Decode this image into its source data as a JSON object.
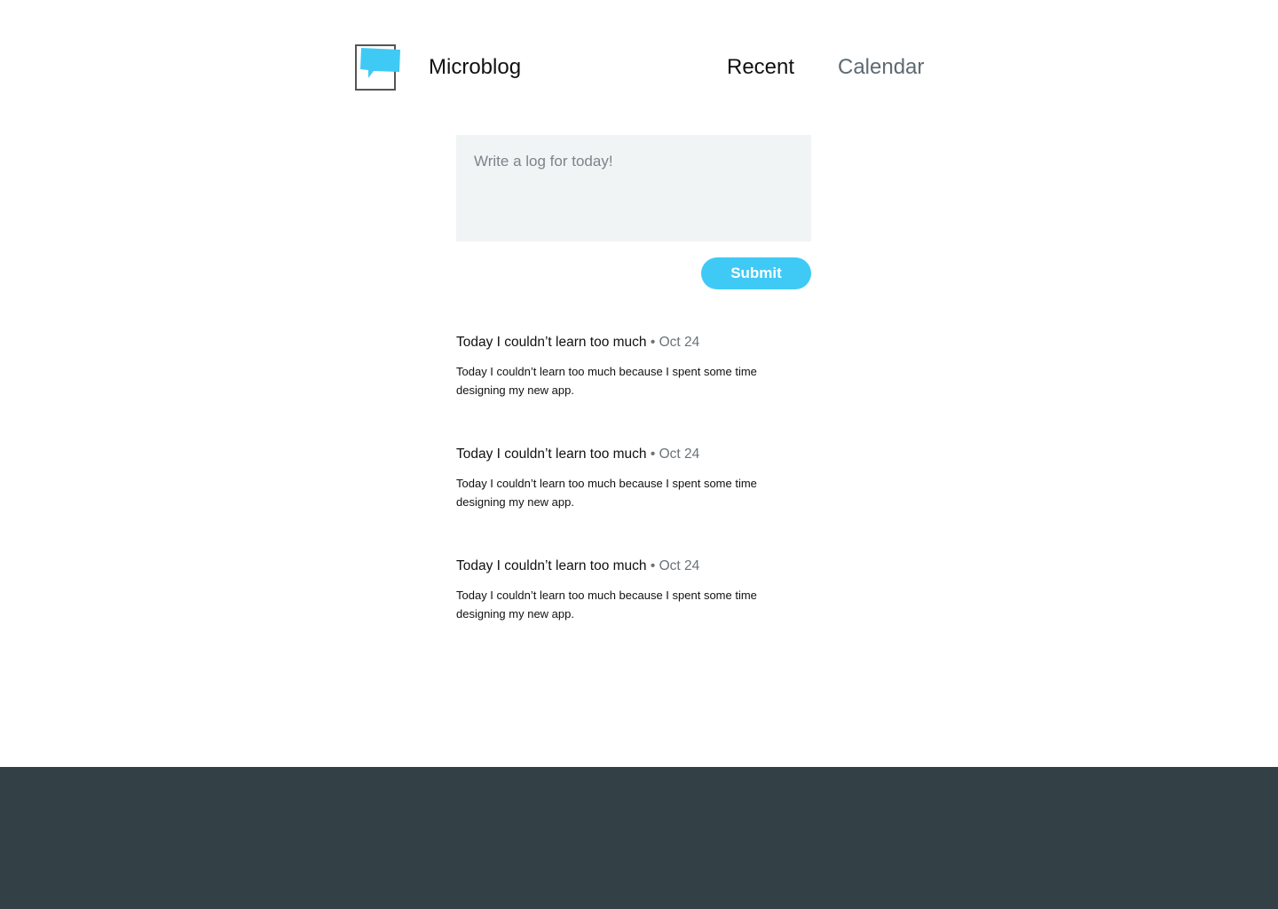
{
  "header": {
    "brand": "Microblog",
    "logo_icon": "speech-bubble-icon",
    "nav": [
      {
        "label": "Recent",
        "active": true
      },
      {
        "label": "Calendar",
        "active": false
      }
    ]
  },
  "composer": {
    "placeholder": "Write a log for today!",
    "value": ""
  },
  "submit_label": "Submit",
  "posts": [
    {
      "title": "Today I couldn’t learn too much",
      "separator": "•",
      "date": "Oct 24",
      "body": "Today I couldn’t learn too much because I spent some time designing my new app."
    },
    {
      "title": "Today I couldn’t learn too much",
      "separator": "•",
      "date": "Oct 24",
      "body": "Today I couldn’t learn too much because I spent some time designing my new app."
    },
    {
      "title": "Today I couldn’t learn too much",
      "separator": "•",
      "date": "Oct 24",
      "body": "Today I couldn’t learn too much because I spent some time designing my new app."
    }
  ],
  "colors": {
    "accent": "#3fcaf5",
    "composer_bg": "#f1f4f5",
    "footer_bg": "#334046",
    "nav_inactive": "#5e6a72"
  }
}
